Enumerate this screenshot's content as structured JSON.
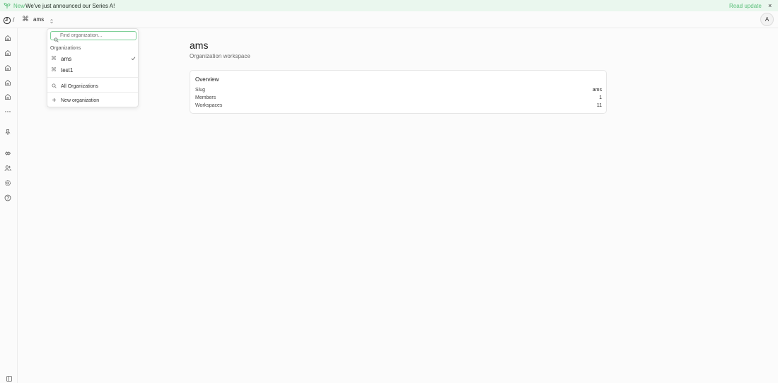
{
  "banner": {
    "new_label": "New",
    "message": "We've just announced our Series A!",
    "link_label": "Read update",
    "close_label": "×"
  },
  "topbar": {
    "separator": "/",
    "org_symbol": "⌘",
    "org_name": "ams",
    "avatar_initial": "A"
  },
  "rail": {
    "icons": [
      "home-icon",
      "home-icon",
      "home-icon",
      "home-icon",
      "home-icon",
      "more-icon",
      "pin-icon",
      "integrations-icon",
      "users-icon",
      "settings-icon",
      "help-icon"
    ]
  },
  "org_dropdown": {
    "search_placeholder": "Find organization...",
    "group_label": "Organizations",
    "items": [
      {
        "symbol": "⌘",
        "label": "ams",
        "selected": true
      },
      {
        "symbol": "⌘",
        "label": "test1",
        "selected": false
      }
    ],
    "all_label": "All Organizations",
    "new_label": "New organization"
  },
  "main": {
    "title": "ams",
    "subtitle": "Organization workspace",
    "overview": {
      "title": "Overview",
      "rows": [
        {
          "key": "Slug",
          "value": "ams"
        },
        {
          "key": "Members",
          "value": "1"
        },
        {
          "key": "Workspaces",
          "value": "11"
        }
      ]
    }
  },
  "colors": {
    "accent_green": "#5bbf7a",
    "banner_bg": "#eaf7ee",
    "search_border": "#7fcf98"
  }
}
